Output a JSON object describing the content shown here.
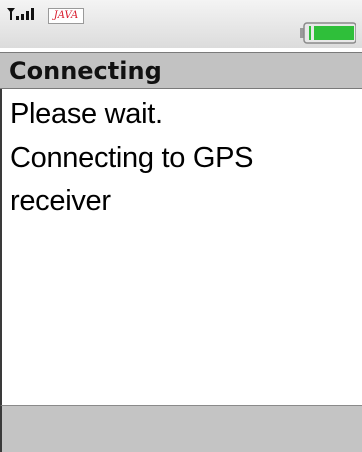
{
  "status_bar": {
    "java_badge": "JAVA",
    "signal_icon": "signal-strength-icon",
    "battery_icon": "battery-icon",
    "colors": {
      "battery_fill": "#2fbf3a",
      "java_text": "#d81a2c"
    }
  },
  "screen": {
    "title": "Connecting",
    "message_lines": [
      "Please wait.",
      "Connecting to GPS",
      "receiver"
    ]
  },
  "colors": {
    "title_bar": "#c2c2c2",
    "softkey_bar": "#c4c4c4",
    "content_bg": "#ffffff"
  }
}
